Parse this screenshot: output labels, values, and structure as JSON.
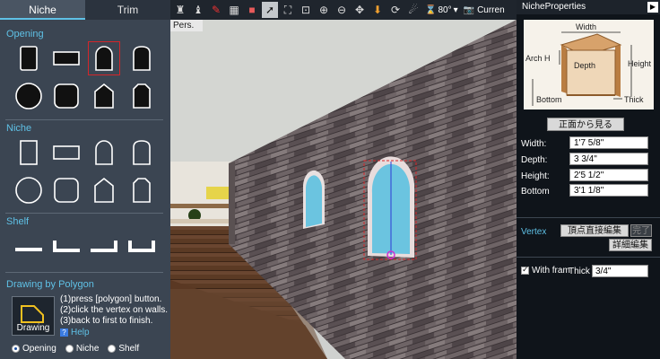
{
  "left_panel": {
    "tabs": [
      {
        "label": "Niche",
        "active": true
      },
      {
        "label": "Trim",
        "active": false
      }
    ],
    "sections": {
      "opening": "Opening",
      "niche": "Niche",
      "shelf": "Shelf",
      "polygon": "Drawing by Polygon"
    },
    "polygon": {
      "button_label": "Drawing",
      "steps": [
        "(1)press [polygon] button.",
        "(2)click the vertex on walls.",
        "(3)back to first to finish."
      ],
      "help_label": "Help"
    },
    "radios": [
      {
        "label": "Opening",
        "checked": true
      },
      {
        "label": "Niche",
        "checked": false
      },
      {
        "label": "Shelf",
        "checked": false
      }
    ]
  },
  "toolbar": {
    "angle_value": "80°",
    "camera_label": "Curren"
  },
  "viewport": {
    "view_mode": "Pers."
  },
  "right_panel": {
    "title": "NicheProperties",
    "diagram_labels": {
      "width": "Width",
      "arch_h": "Arch H",
      "depth": "Depth",
      "height": "Height",
      "bottom": "Bottom",
      "thick": "Thick"
    },
    "front_view_button": "正面から見る",
    "properties": [
      {
        "label": "Width:",
        "value": "1'7 5/8\""
      },
      {
        "label": "Depth:",
        "value": "3 3/4\""
      },
      {
        "label": "Height:",
        "value": "2'5 1/2\""
      },
      {
        "label": "Bottom",
        "value": "3'1 1/8\""
      }
    ],
    "vertex": {
      "label": "Vertex",
      "direct_edit_button": "頂点直接編集",
      "done_button": "完了",
      "detail_edit_button": "詳細編集"
    },
    "frame": {
      "with_frame_label": "With fram",
      "with_frame_checked": true,
      "thick_label": "Thick",
      "thick_value": "3/4\""
    }
  },
  "colors": {
    "accent": "#5fc1e6",
    "selected_outline": "#d4262a",
    "panel_bg": "#3b4552",
    "window_glass": "#6bc4e0"
  }
}
